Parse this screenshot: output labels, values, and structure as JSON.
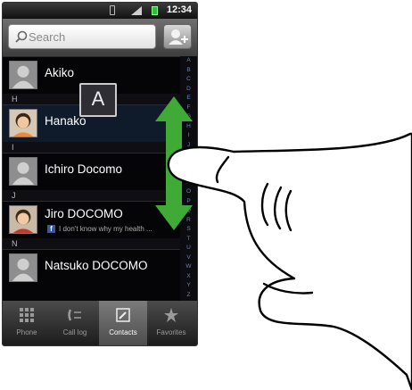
{
  "status_bar": {
    "time": "12:34"
  },
  "search": {
    "placeholder": "Search"
  },
  "index_popup": "A",
  "contacts": [
    {
      "section": "",
      "name": "Akiko",
      "photo": "default-avatar-icon"
    },
    {
      "section": "H",
      "name": "Hanako",
      "photo": "photo"
    },
    {
      "section": "I",
      "name": "Ichiro Docomo",
      "photo": "default-avatar-icon"
    },
    {
      "section": "J",
      "name": "Jiro DOCOMO",
      "photo": "photo",
      "status": "I don't know why my health ..."
    },
    {
      "section": "N",
      "name": "Natsuko DOCOMO",
      "photo": "default-avatar-icon"
    }
  ],
  "fast_scroll": [
    "A",
    "B",
    "C",
    "D",
    "E",
    "F",
    "G",
    "H",
    "I",
    "J",
    "K",
    "L",
    "M",
    "N",
    "O",
    "P",
    "Q",
    "R",
    "S",
    "T",
    "U",
    "V",
    "W",
    "X",
    "Y",
    "Z",
    "#"
  ],
  "tabs": [
    {
      "label": "Phone",
      "icon": "dialpad-icon"
    },
    {
      "label": "Call log",
      "icon": "call-log-icon"
    },
    {
      "label": "Contacts",
      "icon": "contacts-icon"
    },
    {
      "label": "Favorites",
      "icon": "star-icon"
    }
  ],
  "colors": {
    "arrow": "#3faa35",
    "accent": "#6e86b3"
  }
}
